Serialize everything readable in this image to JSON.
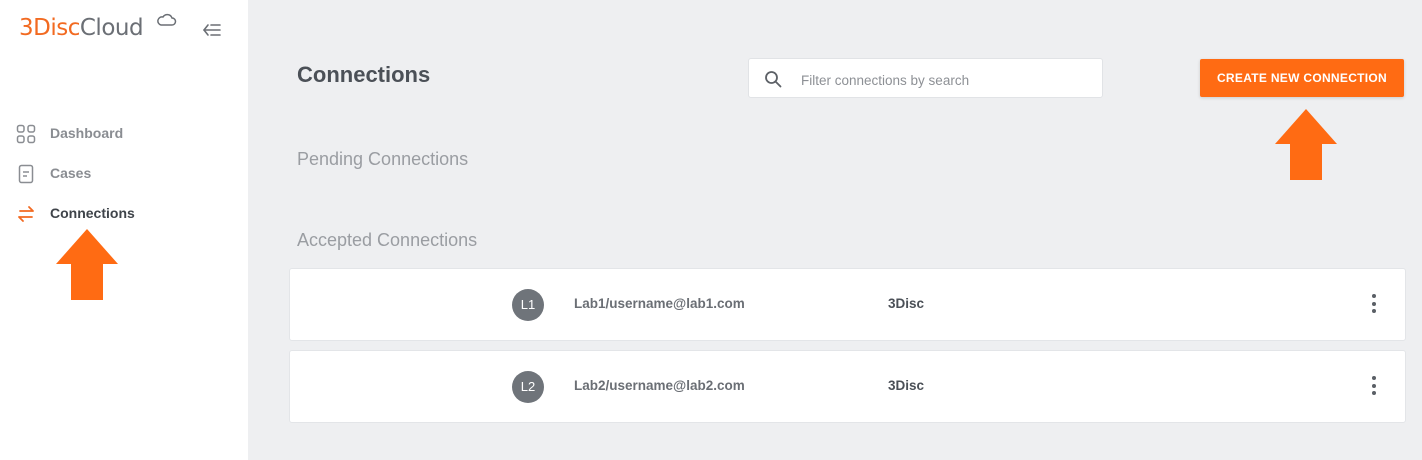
{
  "brand": {
    "part1": "3Disc",
    "part2": "Cloud"
  },
  "sidebar": {
    "items": [
      {
        "label": "Dashboard",
        "icon": "dashboard-grid-icon"
      },
      {
        "label": "Cases",
        "icon": "document-icon"
      },
      {
        "label": "Connections",
        "icon": "swap-arrows-icon",
        "active": true
      }
    ]
  },
  "header": {
    "title": "Connections",
    "search_placeholder": "Filter connections by search",
    "create_label": "CREATE NEW CONNECTION"
  },
  "sections": {
    "pending": "Pending Connections",
    "accepted": "Accepted Connections"
  },
  "connections": [
    {
      "initials": "L1",
      "user": "Lab1/username@lab1.com",
      "org": "3Disc"
    },
    {
      "initials": "L2",
      "user": "Lab2/username@lab2.com",
      "org": "3Disc"
    }
  ],
  "colors": {
    "accent": "#ff6b13",
    "brand_orange": "#f26a21",
    "background": "#eeeff1"
  }
}
